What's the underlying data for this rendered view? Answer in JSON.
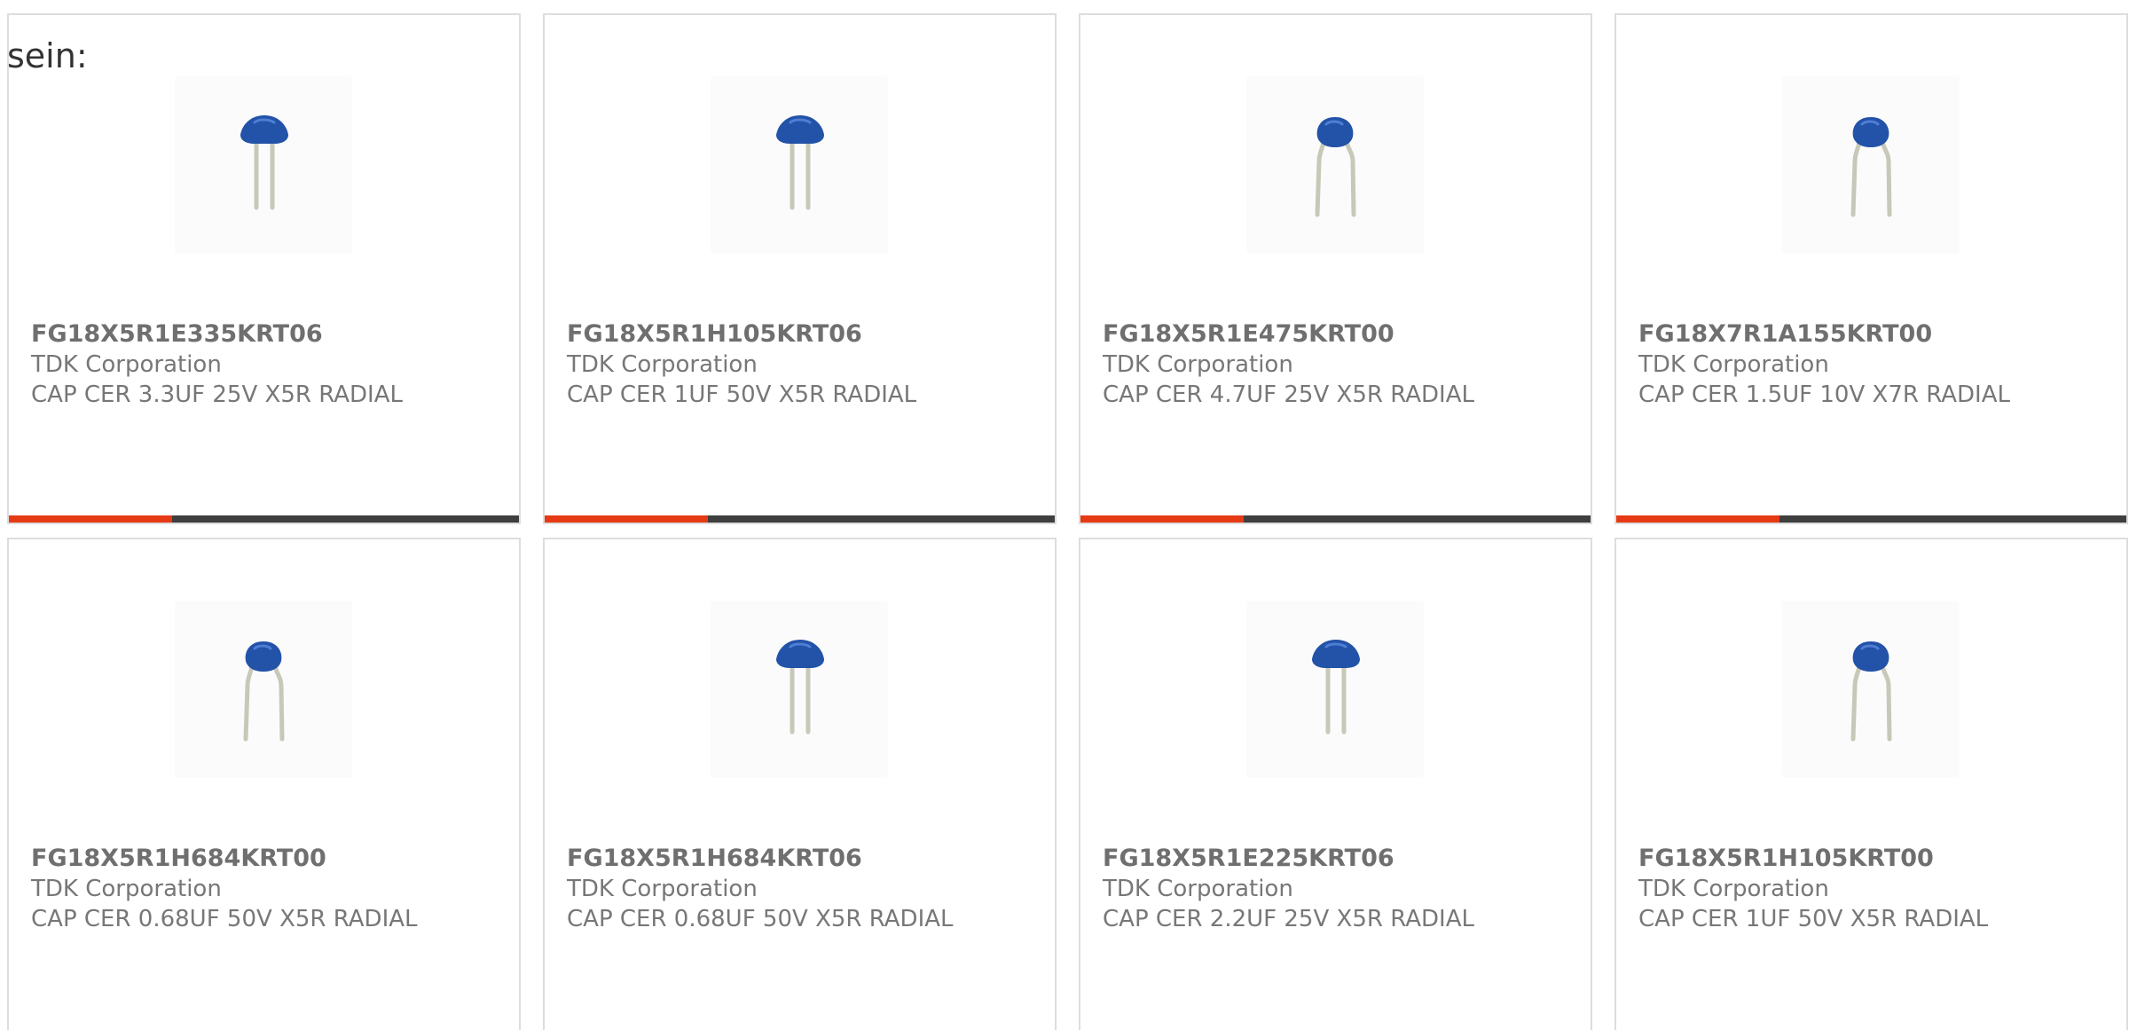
{
  "intro_text": "sein:",
  "colors": {
    "accent_bar": "#e63a15",
    "track_bar": "#3f3f3f",
    "capacitor_body": "#2353a8",
    "lead": "#c8c8b8",
    "card_border": "#dddddd",
    "text": "#777777"
  },
  "products": [
    {
      "part_number": "FG18X5R1E335KRT06",
      "manufacturer": "TDK Corporation",
      "description": "CAP CER 3.3UF 25V X5R RADIAL",
      "image_icon": "radial-capacitor-straight-leads-icon",
      "progress": 0.32
    },
    {
      "part_number": "FG18X5R1H105KRT06",
      "manufacturer": "TDK Corporation",
      "description": "CAP CER 1UF 50V X5R RADIAL",
      "image_icon": "radial-capacitor-straight-leads-icon",
      "progress": 0.32
    },
    {
      "part_number": "FG18X5R1E475KRT00",
      "manufacturer": "TDK Corporation",
      "description": "CAP CER 4.7UF 25V X5R RADIAL",
      "image_icon": "radial-capacitor-kinked-leads-icon",
      "progress": 0.32
    },
    {
      "part_number": "FG18X7R1A155KRT00",
      "manufacturer": "TDK Corporation",
      "description": "CAP CER 1.5UF 10V X7R RADIAL",
      "image_icon": "radial-capacitor-kinked-leads-icon",
      "progress": 0.32
    },
    {
      "part_number": "FG18X5R1H684KRT00",
      "manufacturer": "TDK Corporation",
      "description": "CAP CER 0.68UF 50V X5R RADIAL",
      "image_icon": "radial-capacitor-kinked-leads-icon",
      "progress": 0
    },
    {
      "part_number": "FG18X5R1H684KRT06",
      "manufacturer": "TDK Corporation",
      "description": "CAP CER 0.68UF 50V X5R RADIAL",
      "image_icon": "radial-capacitor-straight-leads-icon",
      "progress": 0
    },
    {
      "part_number": "FG18X5R1E225KRT06",
      "manufacturer": "TDK Corporation",
      "description": "CAP CER 2.2UF 25V X5R RADIAL",
      "image_icon": "radial-capacitor-straight-leads-icon",
      "progress": 0
    },
    {
      "part_number": "FG18X5R1H105KRT00",
      "manufacturer": "TDK Corporation",
      "description": "CAP CER 1UF 50V X5R RADIAL",
      "image_icon": "radial-capacitor-kinked-leads-icon",
      "progress": 0
    }
  ]
}
